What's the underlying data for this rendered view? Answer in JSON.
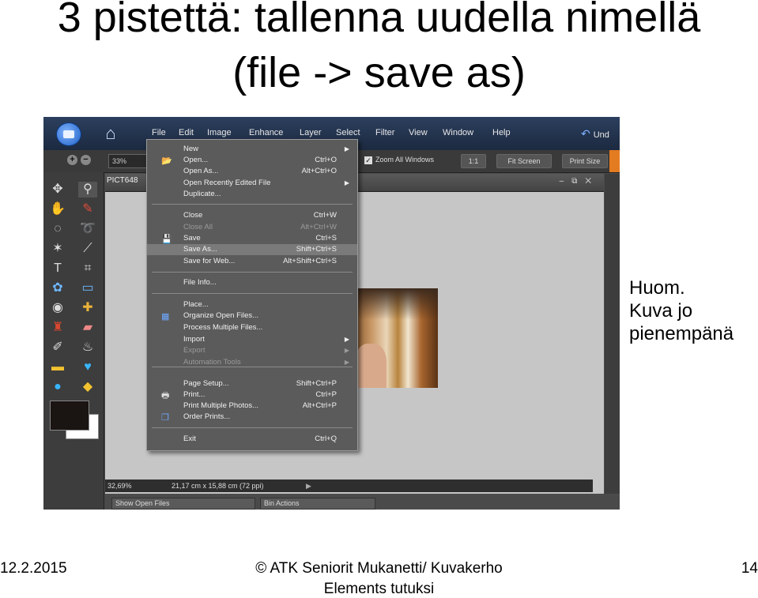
{
  "slide": {
    "title_line1": "3 pistettä: tallenna uudella nimellä",
    "title_line2": "(file -> save as)",
    "note_line1": "Huom.",
    "note_line2": "Kuva jo",
    "note_line3": "pienempänä",
    "footer_date": "12.2.2015",
    "footer_center_line1": "© ATK Seniorit Mukanetti/ Kuvakerho",
    "footer_center_line2": "Elements tutuksi",
    "footer_page": "14"
  },
  "app": {
    "menu": [
      "File",
      "Edit",
      "Image",
      "Enhance",
      "Layer",
      "Select",
      "Filter",
      "View",
      "Window",
      "Help"
    ],
    "undo_label": "Und",
    "zoom_field": "33%",
    "zoom_all_windows": "Zoom All Windows",
    "btn_1to1": "1:1",
    "btn_fit_screen": "Fit Screen",
    "btn_print_size": "Print Size",
    "doc_tab": "PICT648",
    "status_zoom": "32,69%",
    "status_size": "21,17 cm x 15,88 cm (72 ppi)",
    "bottom_left_dropdown": "Show Open Files",
    "bottom_right_dropdown": "Bin Actions"
  },
  "file_menu": [
    {
      "label": "New",
      "shortcut": "",
      "submenu": true,
      "disabled": false,
      "icon": ""
    },
    {
      "label": "Open...",
      "shortcut": "Ctrl+O",
      "submenu": false,
      "disabled": false,
      "icon": "folder-icon"
    },
    {
      "label": "Open As...",
      "shortcut": "Alt+Ctrl+O",
      "submenu": false,
      "disabled": false,
      "icon": ""
    },
    {
      "label": "Open Recently Edited File",
      "shortcut": "",
      "submenu": true,
      "disabled": false,
      "icon": ""
    },
    {
      "label": "Duplicate...",
      "shortcut": "",
      "submenu": false,
      "disabled": false,
      "icon": ""
    },
    {
      "label": "Close",
      "shortcut": "Ctrl+W",
      "submenu": false,
      "disabled": false,
      "icon": ""
    },
    {
      "label": "Close All",
      "shortcut": "Alt+Ctrl+W",
      "submenu": false,
      "disabled": true,
      "icon": ""
    },
    {
      "label": "Save",
      "shortcut": "Ctrl+S",
      "submenu": false,
      "disabled": false,
      "icon": "floppy-icon"
    },
    {
      "label": "Save As...",
      "shortcut": "Shift+Ctrl+S",
      "submenu": false,
      "disabled": false,
      "icon": "",
      "highlighted": true
    },
    {
      "label": "Save for Web...",
      "shortcut": "Alt+Shift+Ctrl+S",
      "submenu": false,
      "disabled": false,
      "icon": ""
    },
    {
      "label": "File Info...",
      "shortcut": "",
      "submenu": false,
      "disabled": false,
      "icon": ""
    },
    {
      "label": "Place...",
      "shortcut": "",
      "submenu": false,
      "disabled": false,
      "icon": ""
    },
    {
      "label": "Organize Open Files...",
      "shortcut": "",
      "submenu": false,
      "disabled": false,
      "icon": "grid-icon"
    },
    {
      "label": "Process Multiple Files...",
      "shortcut": "",
      "submenu": false,
      "disabled": false,
      "icon": ""
    },
    {
      "label": "Import",
      "shortcut": "",
      "submenu": true,
      "disabled": false,
      "icon": ""
    },
    {
      "label": "Export",
      "shortcut": "",
      "submenu": true,
      "disabled": true,
      "icon": ""
    },
    {
      "label": "Automation Tools",
      "shortcut": "",
      "submenu": true,
      "disabled": true,
      "icon": ""
    },
    {
      "label": "Page Setup...",
      "shortcut": "Shift+Ctrl+P",
      "submenu": false,
      "disabled": false,
      "icon": ""
    },
    {
      "label": "Print...",
      "shortcut": "Ctrl+P",
      "submenu": false,
      "disabled": false,
      "icon": "printer-icon"
    },
    {
      "label": "Print Multiple Photos...",
      "shortcut": "Alt+Ctrl+P",
      "submenu": false,
      "disabled": false,
      "icon": ""
    },
    {
      "label": "Order Prints...",
      "shortcut": "",
      "submenu": false,
      "disabled": false,
      "icon": "order-prints-icon"
    },
    {
      "label": "Exit",
      "shortcut": "Ctrl+Q",
      "submenu": false,
      "disabled": false,
      "icon": ""
    }
  ]
}
